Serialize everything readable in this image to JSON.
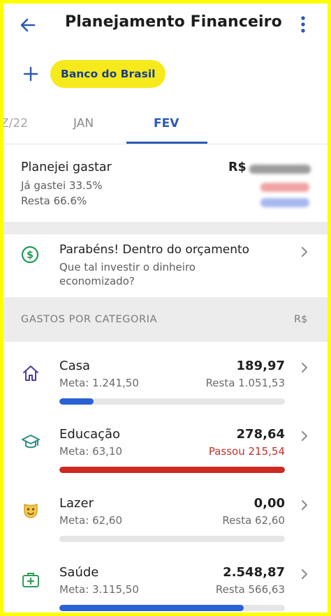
{
  "appbar": {
    "title": "Planejamento Financeiro",
    "back_icon": "arrow-left-icon",
    "menu_icon": "more-vertical-icon"
  },
  "accounts": {
    "add_icon": "plus-icon",
    "selected_chip": "Banco do Brasil"
  },
  "tabs": {
    "items": [
      {
        "label": "Z/22"
      },
      {
        "label": "JAN"
      },
      {
        "label": "FEV"
      }
    ],
    "selected_index": 2
  },
  "summary": {
    "title": "Planejei gastar",
    "spent_line": "Já gastei 33.5%",
    "remaining_line": "Resta 66.6%",
    "currency": "R$"
  },
  "congrats": {
    "icon": "dollar-circle-icon",
    "title": "Parabéns! Dentro do orçamento",
    "subtitle": "Que tal investir o dinheiro economizado?"
  },
  "categories_header": {
    "title": "GASTOS POR CATEGORIA",
    "currency": "R$"
  },
  "categories": [
    {
      "name": "Casa",
      "meta": "Meta: 1.241,50",
      "value": "189,97",
      "status": "Resta 1.051,53",
      "over": false,
      "progress": 0.153,
      "bar_color": "#2a62d6",
      "icon": "house-icon"
    },
    {
      "name": "Educação",
      "meta": "Meta: 63,10",
      "value": "278,64",
      "status": "Passou 215,54",
      "over": true,
      "progress": 1.0,
      "bar_color": "#cc2a22",
      "icon": "graduation-cap-icon"
    },
    {
      "name": "Lazer",
      "meta": "Meta: 62,60",
      "value": "0,00",
      "status": "Resta 62,60",
      "over": false,
      "progress": 0.0,
      "bar_color": "#2a62d6",
      "icon": "theater-mask-icon"
    },
    {
      "name": "Saúde",
      "meta": "Meta: 3.115,50",
      "value": "2.548,87",
      "status": "Resta 566,63",
      "over": false,
      "progress": 0.818,
      "bar_color": "#2a62d6",
      "icon": "first-aid-kit-icon"
    }
  ],
  "colors": {
    "accent_blue": "#2a5ab4",
    "chip_yellow": "#f6ea1c",
    "over_red": "#c0312b",
    "frame_yellow": "#ffff00"
  }
}
